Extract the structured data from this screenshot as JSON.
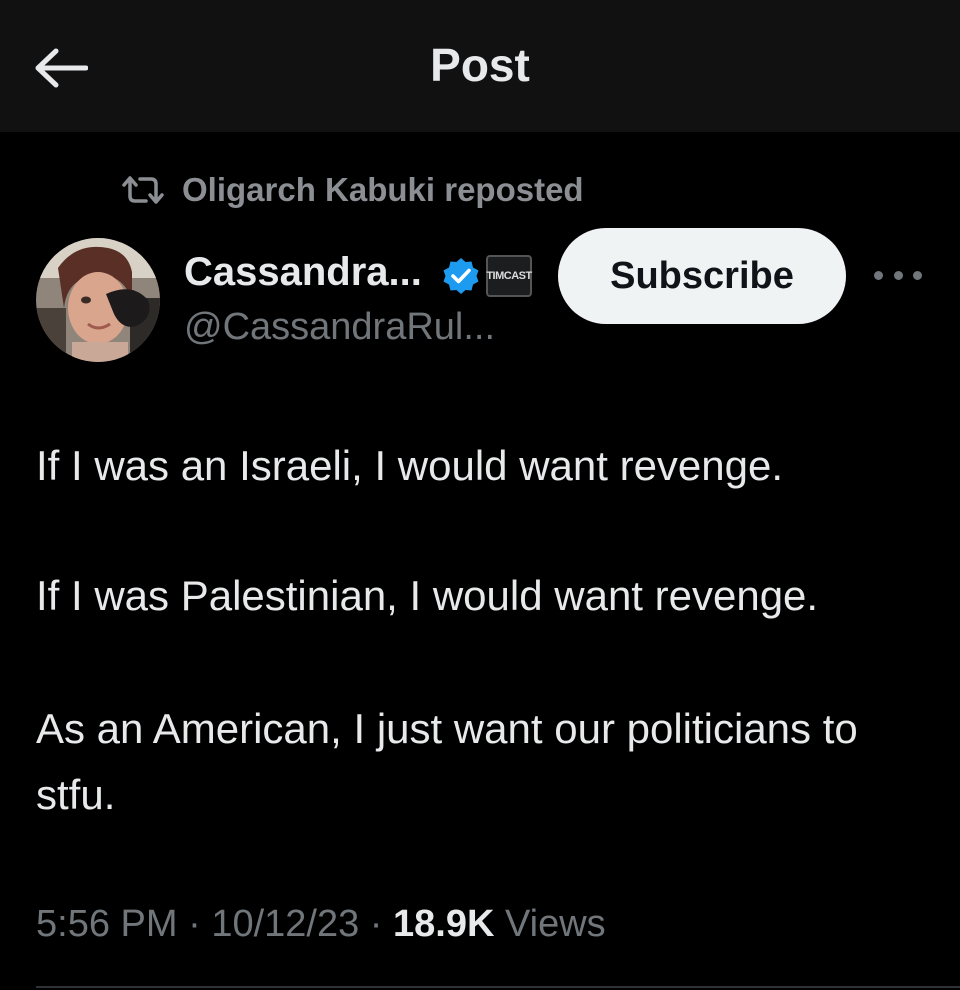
{
  "header": {
    "title": "Post"
  },
  "repost": {
    "text": "Oligarch Kabuki reposted"
  },
  "author": {
    "display_name": "Cassandra...",
    "handle": "@CassandraRul...",
    "affiliate_badge": "TIMCAST",
    "verified_color": "#1d9bf0"
  },
  "actions": {
    "subscribe_label": "Subscribe"
  },
  "post": {
    "paragraph_1": "If I was an Israeli, I would want revenge.",
    "paragraph_2": "If I was Palestinian, I would want revenge.",
    "paragraph_3": "As an American, I just want our politicians to stfu."
  },
  "meta": {
    "time": "5:56 PM",
    "separator": "·",
    "date": "10/12/23",
    "views_count": "18.9K",
    "views_label": "Views"
  },
  "icons": {
    "back": "arrow-left-icon",
    "repost": "repost-icon",
    "verified": "verified-badge-icon",
    "more": "more-horizontal-icon"
  }
}
